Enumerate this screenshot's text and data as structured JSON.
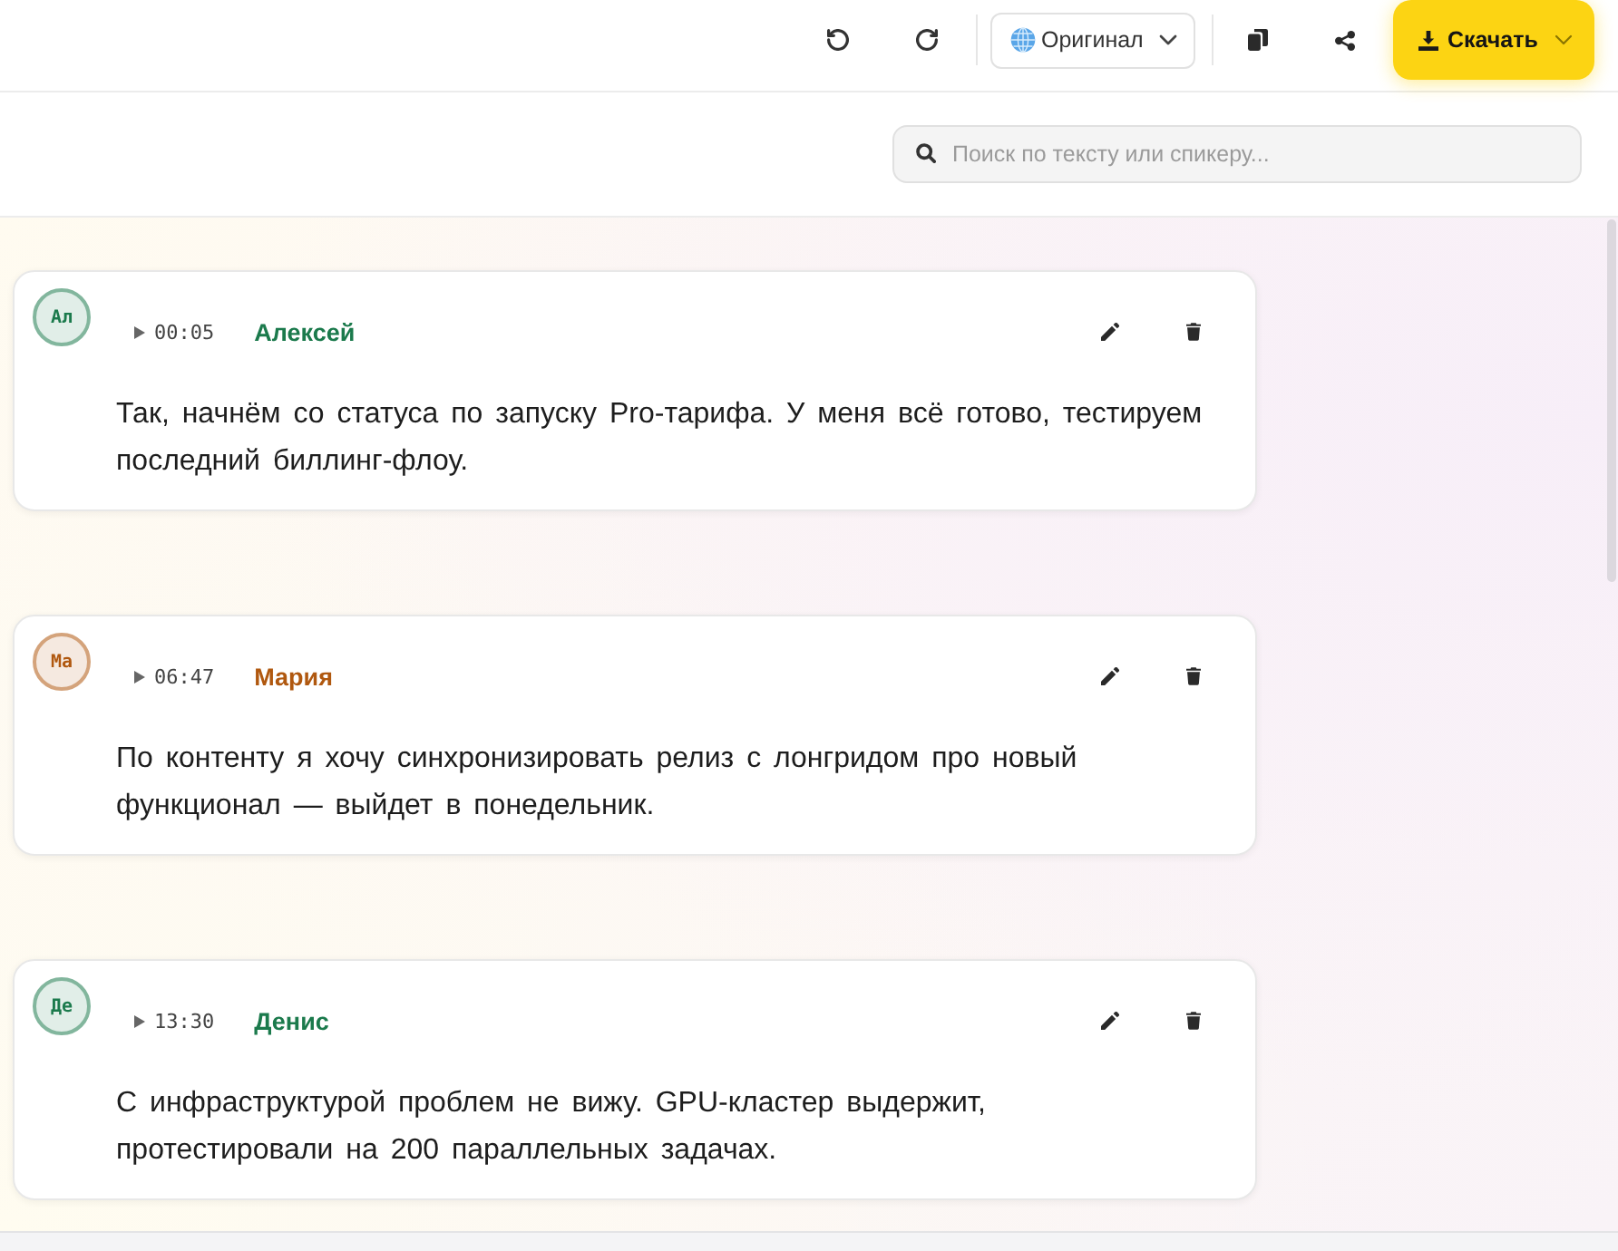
{
  "toolbar": {
    "language": {
      "value": "Оригинал"
    },
    "download": {
      "label": "Скачать"
    }
  },
  "search": {
    "placeholder": "Поиск по тексту или спикеру..."
  },
  "segments": [
    {
      "initials": "Ал",
      "time": "00:05",
      "speaker": "Алексей",
      "color": "#1b7a4c",
      "text": "Так, начнём со статуса по запуску Pro-тарифа. У меня всё готово, тестируем последний биллинг-флоу."
    },
    {
      "initials": "Ма",
      "time": "06:47",
      "speaker": "Мария",
      "color": "#b0580f",
      "text": "По контенту я хочу синхронизировать релиз с лонгридом про новый функционал — выйдет в понедельник."
    },
    {
      "initials": "Де",
      "time": "13:30",
      "speaker": "Денис",
      "color": "#1b7a4c",
      "text": "С инфраструктурой проблем не вижу. GPU-кластер выдержит, протестировали на 200 параллельных задачах."
    }
  ]
}
